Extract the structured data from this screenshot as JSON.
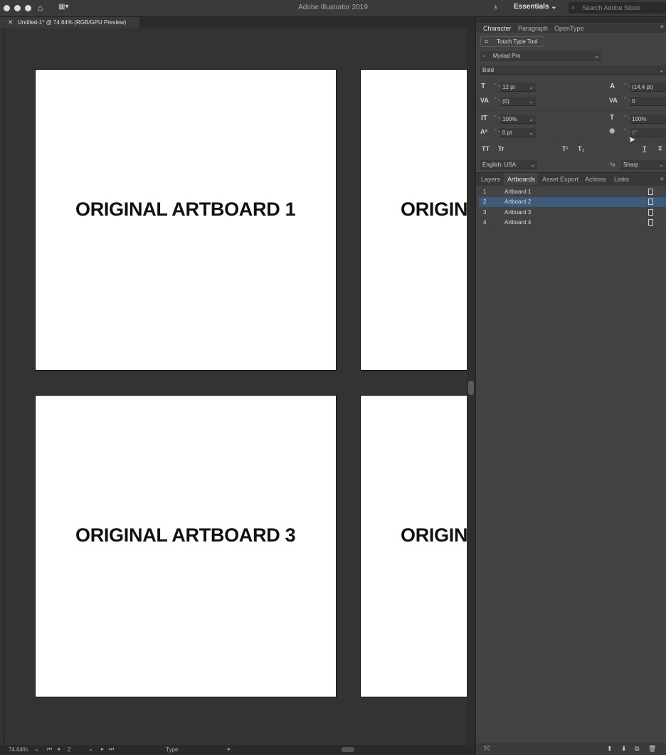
{
  "app": {
    "title": "Adobe Illustrator 2019",
    "workspace": "Essentials",
    "search_placeholder": "Search Adobe Stock"
  },
  "document": {
    "tab_label": "Untitled-1* @ 74.64% (RGB/GPU Preview)"
  },
  "artboards_canvas": {
    "labels": [
      "ORIGINAL ARTBOARD 1",
      "ORIGIN",
      "ORIGINAL ARTBOARD 3",
      "ORIGIN"
    ]
  },
  "character_panel": {
    "tabs": [
      "Character",
      "Paragraph",
      "OpenType"
    ],
    "touch_type_tool": "Touch Type Tool",
    "font_family": "Myriad Pro",
    "font_style": "Bold",
    "font_size": "12 pt",
    "leading": "(14.4 pt)",
    "kerning": "(0)",
    "tracking": "0",
    "vertical_scale": "100%",
    "horizontal_scale": "100%",
    "baseline_shift": "0 pt",
    "rotation": "0°",
    "language": "English: USA",
    "anti_alias": "Sharp",
    "style_buttons": [
      "TT",
      "Tr",
      "T¹",
      "T₁",
      "T",
      "T"
    ]
  },
  "artboards_panel": {
    "tabs": [
      "Layers",
      "Artboards",
      "Asset Export",
      "Actions",
      "Links"
    ],
    "rows": [
      {
        "num": "1",
        "name": "Artboard 1"
      },
      {
        "num": "2",
        "name": "Artboard 2"
      },
      {
        "num": "3",
        "name": "Artboard 3"
      },
      {
        "num": "4",
        "name": "Artboard 4"
      }
    ],
    "selected_row": 2
  },
  "status_bar": {
    "zoom": "74.64%",
    "artboard_index": "2",
    "tool": "Type"
  }
}
